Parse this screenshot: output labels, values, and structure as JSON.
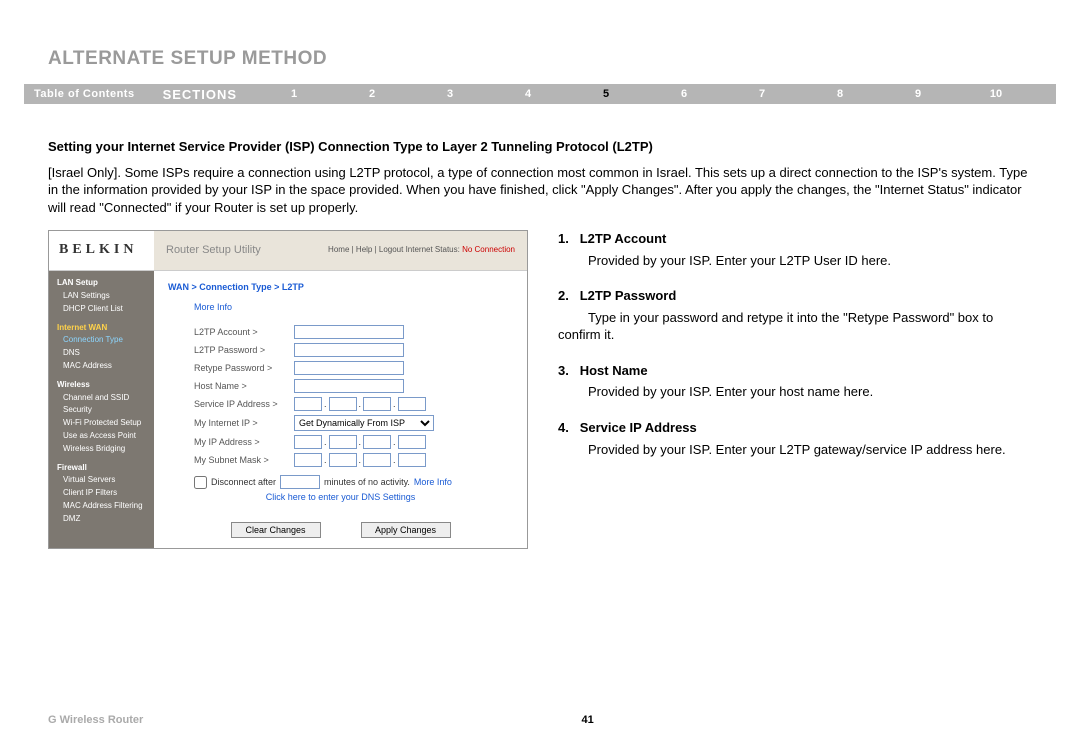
{
  "header": {
    "title": "ALTERNATE SETUP METHOD"
  },
  "nav": {
    "toc": "Table of Contents",
    "sections_label": "SECTIONS",
    "numbers": [
      "1",
      "2",
      "3",
      "4",
      "5",
      "6",
      "7",
      "8",
      "9",
      "10"
    ],
    "active": "5"
  },
  "intro": {
    "heading": "Setting your Internet Service Provider (ISP) Connection Type to Layer 2 Tunneling Protocol (L2TP)",
    "para": "[Israel Only]. Some ISPs require a connection using L2TP protocol, a type of connection most common in Israel. This sets up a direct connection to the ISP's system. Type in the information provided by your ISP in the space provided. When you have finished, click \"Apply Changes\". After you apply the changes, the \"Internet Status\" indicator will read \"Connected\" if your Router is set up properly."
  },
  "screenshot": {
    "logo": "BELKIN",
    "title": "Router Setup Utility",
    "header_links": "Home | Help | Logout   Internet Status:",
    "status": "No Connection",
    "sidebar": {
      "groups": [
        {
          "cat": "LAN Setup",
          "items": [
            "LAN Settings",
            "DHCP Client List"
          ],
          "active": false
        },
        {
          "cat": "Internet WAN",
          "items": [
            "Connection Type",
            "DNS",
            "MAC Address"
          ],
          "active": true,
          "active_item": "Connection Type"
        },
        {
          "cat": "Wireless",
          "items": [
            "Channel and SSID",
            "Security",
            "Wi-Fi Protected Setup",
            "Use as Access Point",
            "Wireless Bridging"
          ],
          "active": false
        },
        {
          "cat": "Firewall",
          "items": [
            "Virtual Servers",
            "Client IP Filters",
            "MAC Address Filtering",
            "DMZ"
          ],
          "active": false
        }
      ]
    },
    "breadcrumb": "WAN > Connection Type > L2TP",
    "more_info": "More Info",
    "fields": {
      "account": "L2TP Account >",
      "password": "L2TP Password >",
      "retype": "Retype Password >",
      "host": "Host Name >",
      "service_ip": "Service IP Address >",
      "my_internet_ip": "My Internet IP >",
      "my_ip": "My IP Address >",
      "subnet": "My Subnet Mask >"
    },
    "select_option": "Get Dynamically From ISP",
    "disconnect_label_pre": "Disconnect after",
    "disconnect_label_post": "minutes of no activity.",
    "disconnect_more": "More Info",
    "dns_link": "Click here to enter your DNS Settings",
    "btn_clear": "Clear Changes",
    "btn_apply": "Apply Changes"
  },
  "fields_desc": [
    {
      "num": "1.",
      "title": "L2TP Account",
      "desc": "Provided by your ISP. Enter your L2TP User ID here."
    },
    {
      "num": "2.",
      "title": "L2TP Password",
      "desc": "Type in your password and retype it into the \"Retype Password\" box to confirm it."
    },
    {
      "num": "3.",
      "title": "Host Name",
      "desc": "Provided by your ISP. Enter your host name here."
    },
    {
      "num": "4.",
      "title": "Service IP Address",
      "desc": "Provided by your ISP. Enter your L2TP gateway/service IP address here."
    }
  ],
  "footer": {
    "product": "G Wireless Router",
    "page": "41"
  }
}
